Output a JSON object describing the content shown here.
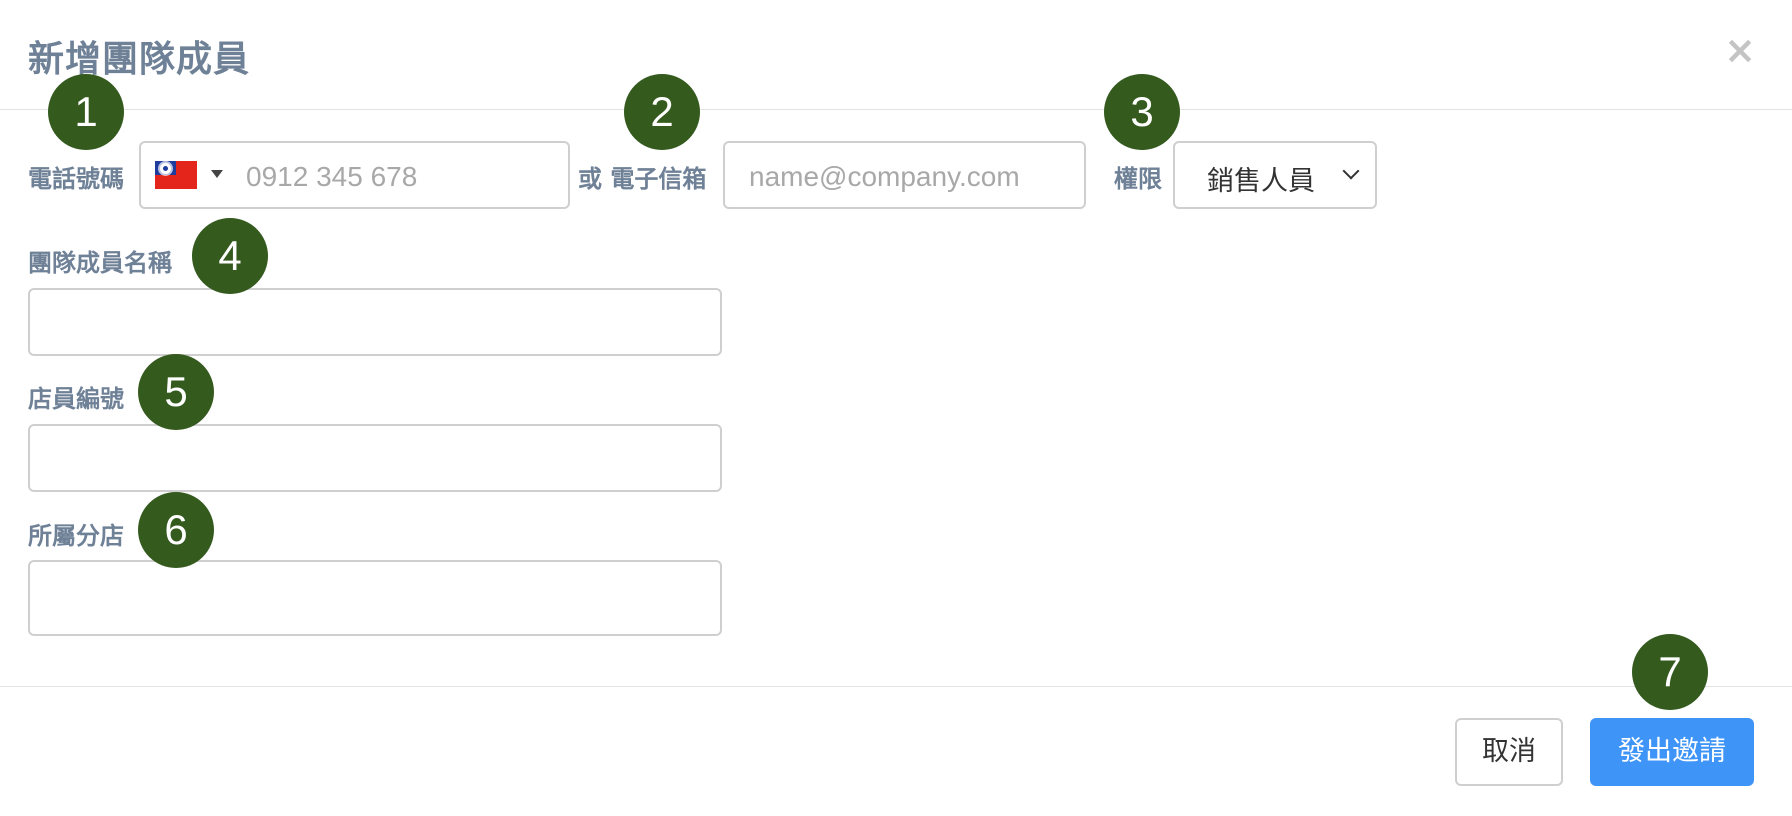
{
  "modal": {
    "title": "新增團隊成員",
    "close_label": "×"
  },
  "form": {
    "phone": {
      "label": "電話號碼",
      "country_flag": "taiwan-flag",
      "placeholder": "0912 345 678",
      "value": ""
    },
    "email": {
      "label": "或 電子信箱",
      "placeholder": "name@company.com",
      "value": ""
    },
    "role": {
      "label": "權限",
      "selected": "銷售人員"
    },
    "member_name": {
      "label": "團隊成員名稱",
      "value": ""
    },
    "staff_id": {
      "label": "店員編號",
      "value": ""
    },
    "branch": {
      "label": "所屬分店",
      "value": ""
    }
  },
  "footer": {
    "cancel_label": "取消",
    "send_label": "發出邀請"
  },
  "annotations": [
    "1",
    "2",
    "3",
    "4",
    "5",
    "6",
    "7"
  ],
  "colors": {
    "label": "#6f8197",
    "primary_button": "#3f95f7",
    "annotation_badge": "#345a1e"
  }
}
